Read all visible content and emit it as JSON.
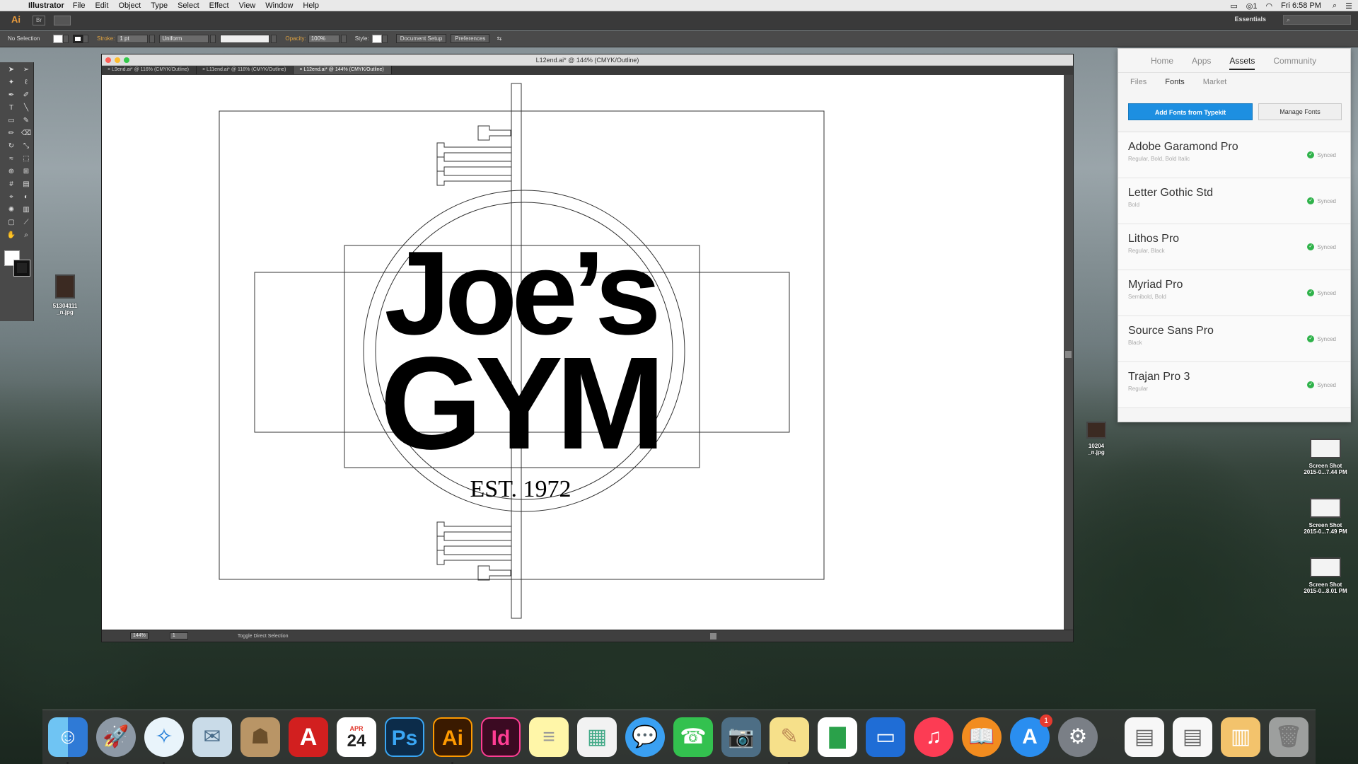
{
  "menubar": {
    "app_name": "Illustrator",
    "items": [
      "File",
      "Edit",
      "Object",
      "Type",
      "Select",
      "Effect",
      "View",
      "Window",
      "Help"
    ],
    "clock": "Fri 6:58 PM",
    "cc_count": "1"
  },
  "appbar": {
    "logo": "Ai",
    "bridge": "Br",
    "workspace": "Essentials",
    "search_placeholder": ""
  },
  "controlbar": {
    "selection": "No Selection",
    "stroke_label": "Stroke:",
    "stroke_weight": "1 pt",
    "profile": "Uniform",
    "opacity_label": "Opacity:",
    "opacity_value": "100%",
    "style_label": "Style:",
    "document_setup": "Document Setup",
    "preferences": "Preferences"
  },
  "document": {
    "title": "L12end.ai* @ 144% (CMYK/Outline)",
    "tabs": [
      {
        "label": "L9end.ai* @ 116% (CMYK/Outline)"
      },
      {
        "label": "L11end.ai* @ 118% (CMYK/Outline)"
      },
      {
        "label": "L12end.ai* @ 144% (CMYK/Outline)"
      }
    ],
    "zoom": "144%",
    "page": "1",
    "status": "Toggle Direct Selection"
  },
  "artwork": {
    "line1": "Joe’s",
    "line2": "GYM",
    "est": "EST. 1972"
  },
  "desktop_files": [
    {
      "label1": "51304111",
      "label2": "_n.jpg"
    },
    {
      "label1": "10204",
      "label2": "_n.jpg"
    },
    {
      "label1": "Screen Shot",
      "label2": "2015-0...7.44 PM"
    },
    {
      "label1": "Screen Shot",
      "label2": "2015-0...7.49 PM"
    },
    {
      "label1": "Screen Shot",
      "label2": "2015-0...8.01 PM"
    }
  ],
  "cc_panel": {
    "nav": [
      "Home",
      "Apps",
      "Assets",
      "Community"
    ],
    "subnav": [
      "Files",
      "Fonts",
      "Market"
    ],
    "add_fonts": "Add Fonts from Typekit",
    "manage_fonts": "Manage Fonts",
    "fonts": [
      {
        "name": "Adobe Garamond Pro",
        "styles": "Regular, Bold, Bold Italic",
        "status": "Synced"
      },
      {
        "name": "Letter Gothic Std",
        "styles": "Bold",
        "status": "Synced"
      },
      {
        "name": "Lithos Pro",
        "styles": "Regular, Black",
        "status": "Synced"
      },
      {
        "name": "Myriad Pro",
        "styles": "Semibold, Bold",
        "status": "Synced"
      },
      {
        "name": "Source Sans Pro",
        "styles": "Black",
        "status": "Synced"
      },
      {
        "name": "Trajan Pro 3",
        "styles": "Regular",
        "status": "Synced"
      }
    ]
  },
  "dock": {
    "calendar_month": "APR",
    "calendar_day": "24",
    "appstore_badge": "1",
    "ps": "Ps",
    "ai": "Ai",
    "id": "Id"
  }
}
